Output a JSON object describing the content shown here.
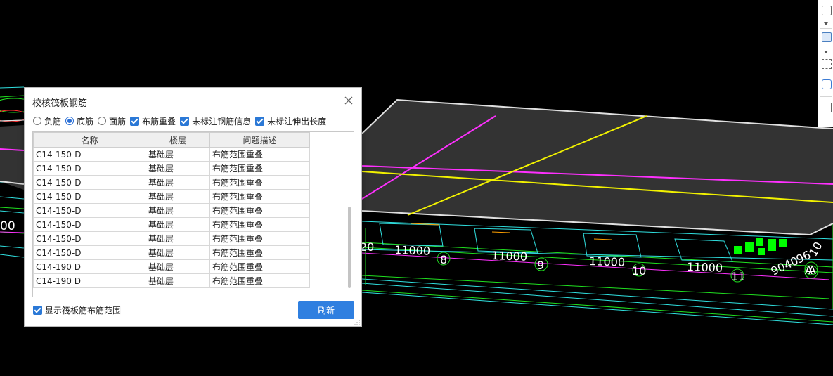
{
  "dialog": {
    "title": "校核筏板钢筋",
    "options": [
      {
        "kind": "radio",
        "label": "负筋",
        "checked": false
      },
      {
        "kind": "radio",
        "label": "底筋",
        "checked": true
      },
      {
        "kind": "radio",
        "label": "面筋",
        "checked": false
      },
      {
        "kind": "checkbox",
        "label": "布筋重叠",
        "checked": true
      },
      {
        "kind": "checkbox",
        "label": "未标注钢筋信息",
        "checked": true
      },
      {
        "kind": "checkbox",
        "label": "未标注伸出长度",
        "checked": true
      }
    ],
    "table": {
      "columns": [
        "名称",
        "楼层",
        "问题描述"
      ],
      "rows": [
        [
          "C14-150-D",
          "基础层",
          "布筋范围重叠"
        ],
        [
          "C14-150-D",
          "基础层",
          "布筋范围重叠"
        ],
        [
          "C14-150-D",
          "基础层",
          "布筋范围重叠"
        ],
        [
          "C14-150-D",
          "基础层",
          "布筋范围重叠"
        ],
        [
          "C14-150-D",
          "基础层",
          "布筋范围重叠"
        ],
        [
          "C14-150-D",
          "基础层",
          "布筋范围重叠"
        ],
        [
          "C14-150-D",
          "基础层",
          "布筋范围重叠"
        ],
        [
          "C14-150-D",
          "基础层",
          "布筋范围重叠"
        ],
        [
          "C14-190 D",
          "基础层",
          "布筋范围重叠"
        ],
        [
          "C14-190 D",
          "基础层",
          "布筋范围重叠"
        ]
      ]
    },
    "show_range_label": "显示筏板筋布筋范围",
    "show_range_checked": true,
    "refresh_label": "刷新"
  },
  "viewport": {
    "dimension_labels": [
      "00",
      "20",
      "11000",
      "11000",
      "11000",
      "11000",
      "9040",
      "96",
      "10"
    ],
    "axis_labels": [
      "8",
      "9",
      "10",
      "11",
      "A",
      "A"
    ],
    "colors": {
      "background": "#000000",
      "slab": "#333333",
      "slab_edge": "#e0e0e0",
      "magenta_line": "#ff30ff",
      "yellow_line": "#f2f200",
      "cyan_line": "#30e0e0",
      "green_line": "#20e020",
      "marker": "#00ff00"
    }
  },
  "accent_color": "#2f7fe0"
}
